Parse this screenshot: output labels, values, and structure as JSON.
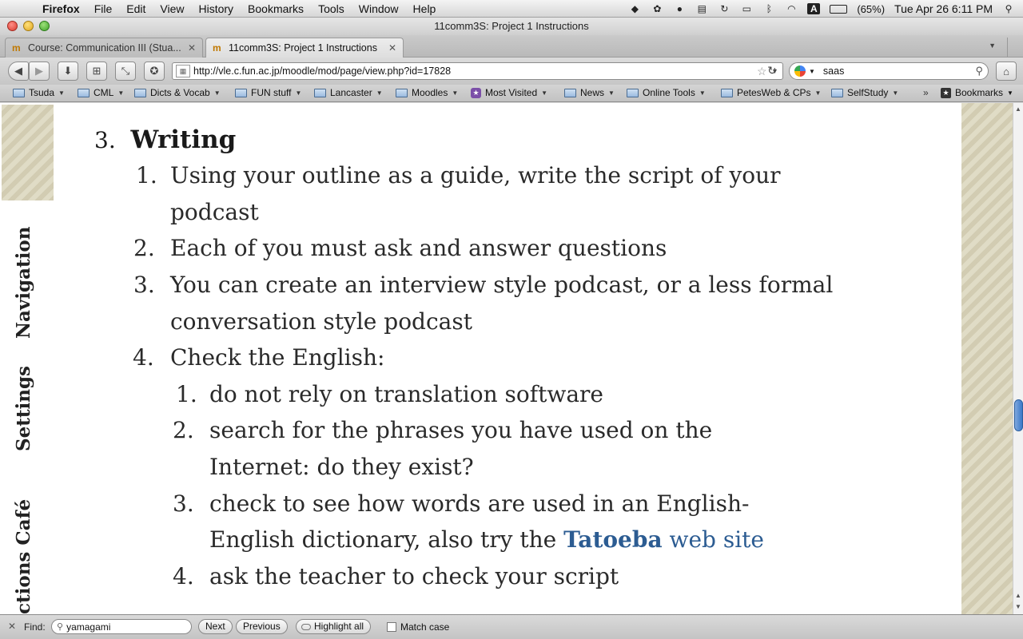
{
  "menubar": {
    "app": "Firefox",
    "items": [
      "File",
      "Edit",
      "View",
      "History",
      "Bookmarks",
      "Tools",
      "Window",
      "Help"
    ],
    "battery": "(65%)",
    "clock": "Tue Apr 26  6:11 PM"
  },
  "window": {
    "title": "11comm3S: Project 1 Instructions"
  },
  "tabs": [
    {
      "label": "Course: Communication III (Stua...",
      "active": false
    },
    {
      "label": "11comm3S: Project 1 Instructions",
      "active": true
    }
  ],
  "navbar": {
    "url": "http://vle.c.fun.ac.jp/moodle/mod/page/view.php?id=17828",
    "search_value": "saas"
  },
  "bookmarks": [
    {
      "label": "Tsuda",
      "icon": "folder-icon"
    },
    {
      "label": "CML",
      "icon": "folder-icon"
    },
    {
      "label": "Dicts & Vocab",
      "icon": "folder-icon"
    },
    {
      "label": "FUN stuff",
      "icon": "folder-icon"
    },
    {
      "label": "Lancaster",
      "icon": "folder-icon"
    },
    {
      "label": "Moodles",
      "icon": "folder-icon"
    },
    {
      "label": "Most Visited",
      "icon": "most-visited-icon"
    },
    {
      "label": "News",
      "icon": "folder-icon"
    },
    {
      "label": "Online Tools",
      "icon": "folder-icon"
    },
    {
      "label": "PetesWeb & CPs",
      "icon": "folder-icon"
    },
    {
      "label": "SelfStudy",
      "icon": "folder-icon"
    }
  ],
  "bookmarks_menu": "Bookmarks",
  "sidebar": {
    "navigation": "Navigation",
    "settings": "Settings",
    "cafe": "ctions Café"
  },
  "doc": {
    "section_num": "3.",
    "section_title": "Writing",
    "items": [
      {
        "num": "1.",
        "lines": [
          "Using your outline as a guide, write the script of your",
          "podcast"
        ]
      },
      {
        "num": "2.",
        "lines": [
          "Each of you must ask and answer questions"
        ]
      },
      {
        "num": "3.",
        "lines": [
          "You can create an interview style podcast, or a less formal",
          "conversation style podcast"
        ]
      },
      {
        "num": "4.",
        "lines": [
          "Check the English:"
        ]
      }
    ],
    "subitems": [
      {
        "num": "1.",
        "lines": [
          "do not rely on translation software"
        ]
      },
      {
        "num": "2.",
        "lines": [
          "search for the phrases you have used on the",
          "Internet: do they exist?"
        ]
      },
      {
        "num": "3.",
        "lines": [
          "check to see how words are used in an English-",
          "English dictionary, also try the "
        ]
      },
      {
        "num": "4.",
        "lines": [
          "ask the teacher to check your script"
        ]
      }
    ],
    "link_bold": "Tatoeba",
    "link_rest": " web site"
  },
  "findbar": {
    "label": "Find:",
    "value": "yamagami",
    "next": "Next",
    "previous": "Previous",
    "highlight": "Highlight all",
    "match_case": "Match case"
  },
  "colors": {
    "link": "#2c5c92",
    "stripe": "#d2ccb2",
    "scroll_thumb": "#3a78c8"
  }
}
